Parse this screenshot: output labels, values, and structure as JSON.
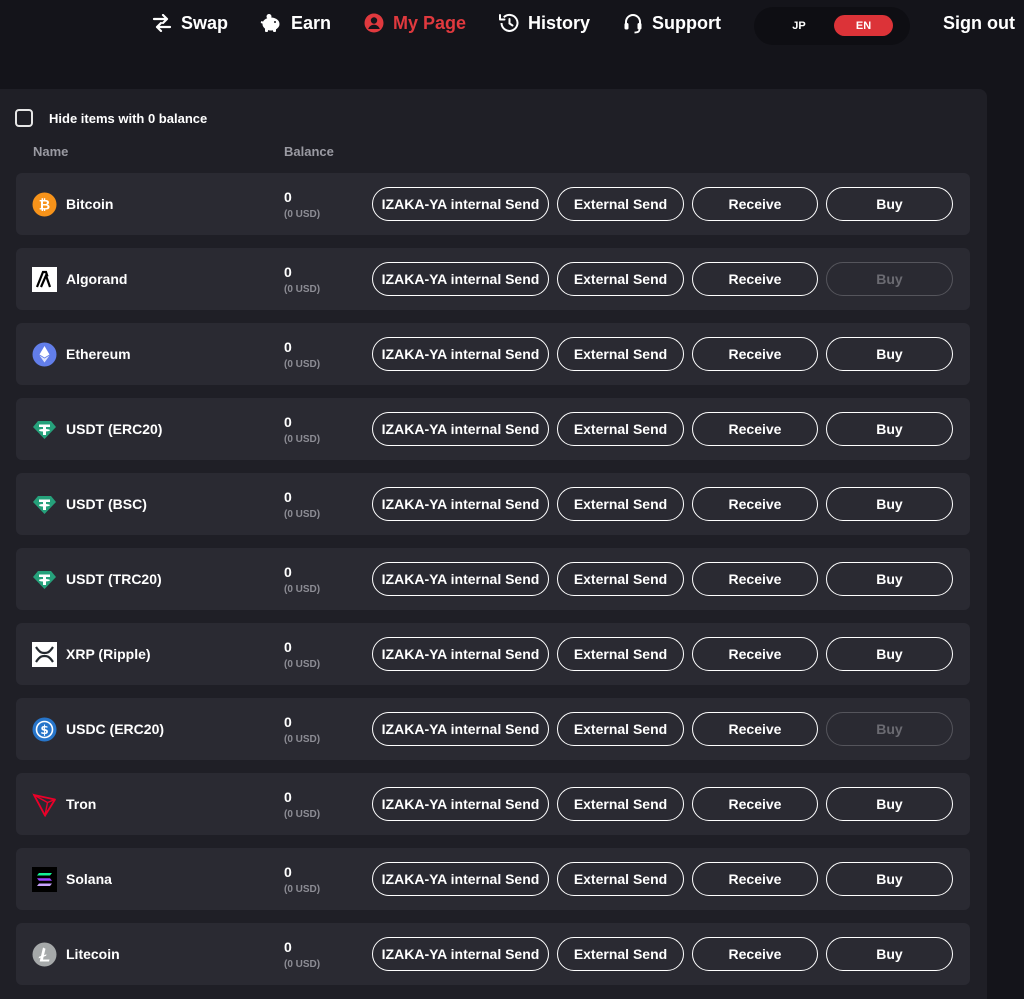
{
  "nav": {
    "swap": "Swap",
    "earn": "Earn",
    "mypage": "My Page",
    "history": "History",
    "support": "Support"
  },
  "lang": {
    "jp": "JP",
    "en": "EN",
    "active": "EN"
  },
  "signout": "Sign out",
  "colors": {
    "accent": "#e0393e",
    "panel": "#1f1f26",
    "row": "#2a2a32"
  },
  "filter": {
    "hide_zero_label": "Hide items with 0 balance",
    "checked": false
  },
  "table": {
    "headers": {
      "name": "Name",
      "balance": "Balance"
    },
    "actions": {
      "internal": "IZAKA-YA internal Send",
      "external": "External Send",
      "receive": "Receive",
      "buy": "Buy"
    },
    "rows": [
      {
        "name": "Bitcoin",
        "icon": "bitcoin-icon",
        "balance": "0",
        "usd": "(0 USD)",
        "buy_enabled": true
      },
      {
        "name": "Algorand",
        "icon": "algorand-icon",
        "balance": "0",
        "usd": "(0 USD)",
        "buy_enabled": false
      },
      {
        "name": "Ethereum",
        "icon": "ethereum-icon",
        "balance": "0",
        "usd": "(0 USD)",
        "buy_enabled": true
      },
      {
        "name": "USDT (ERC20)",
        "icon": "tether-icon",
        "balance": "0",
        "usd": "(0 USD)",
        "buy_enabled": true
      },
      {
        "name": "USDT (BSC)",
        "icon": "tether-icon",
        "balance": "0",
        "usd": "(0 USD)",
        "buy_enabled": true
      },
      {
        "name": "USDT (TRC20)",
        "icon": "tether-icon",
        "balance": "0",
        "usd": "(0 USD)",
        "buy_enabled": true
      },
      {
        "name": "XRP (Ripple)",
        "icon": "xrp-icon",
        "balance": "0",
        "usd": "(0 USD)",
        "buy_enabled": true
      },
      {
        "name": "USDC (ERC20)",
        "icon": "usdc-icon",
        "balance": "0",
        "usd": "(0 USD)",
        "buy_enabled": false
      },
      {
        "name": "Tron",
        "icon": "tron-icon",
        "balance": "0",
        "usd": "(0 USD)",
        "buy_enabled": true
      },
      {
        "name": "Solana",
        "icon": "solana-icon",
        "balance": "0",
        "usd": "(0 USD)",
        "buy_enabled": true
      },
      {
        "name": "Litecoin",
        "icon": "litecoin-icon",
        "balance": "0",
        "usd": "(0 USD)",
        "buy_enabled": true
      }
    ]
  }
}
